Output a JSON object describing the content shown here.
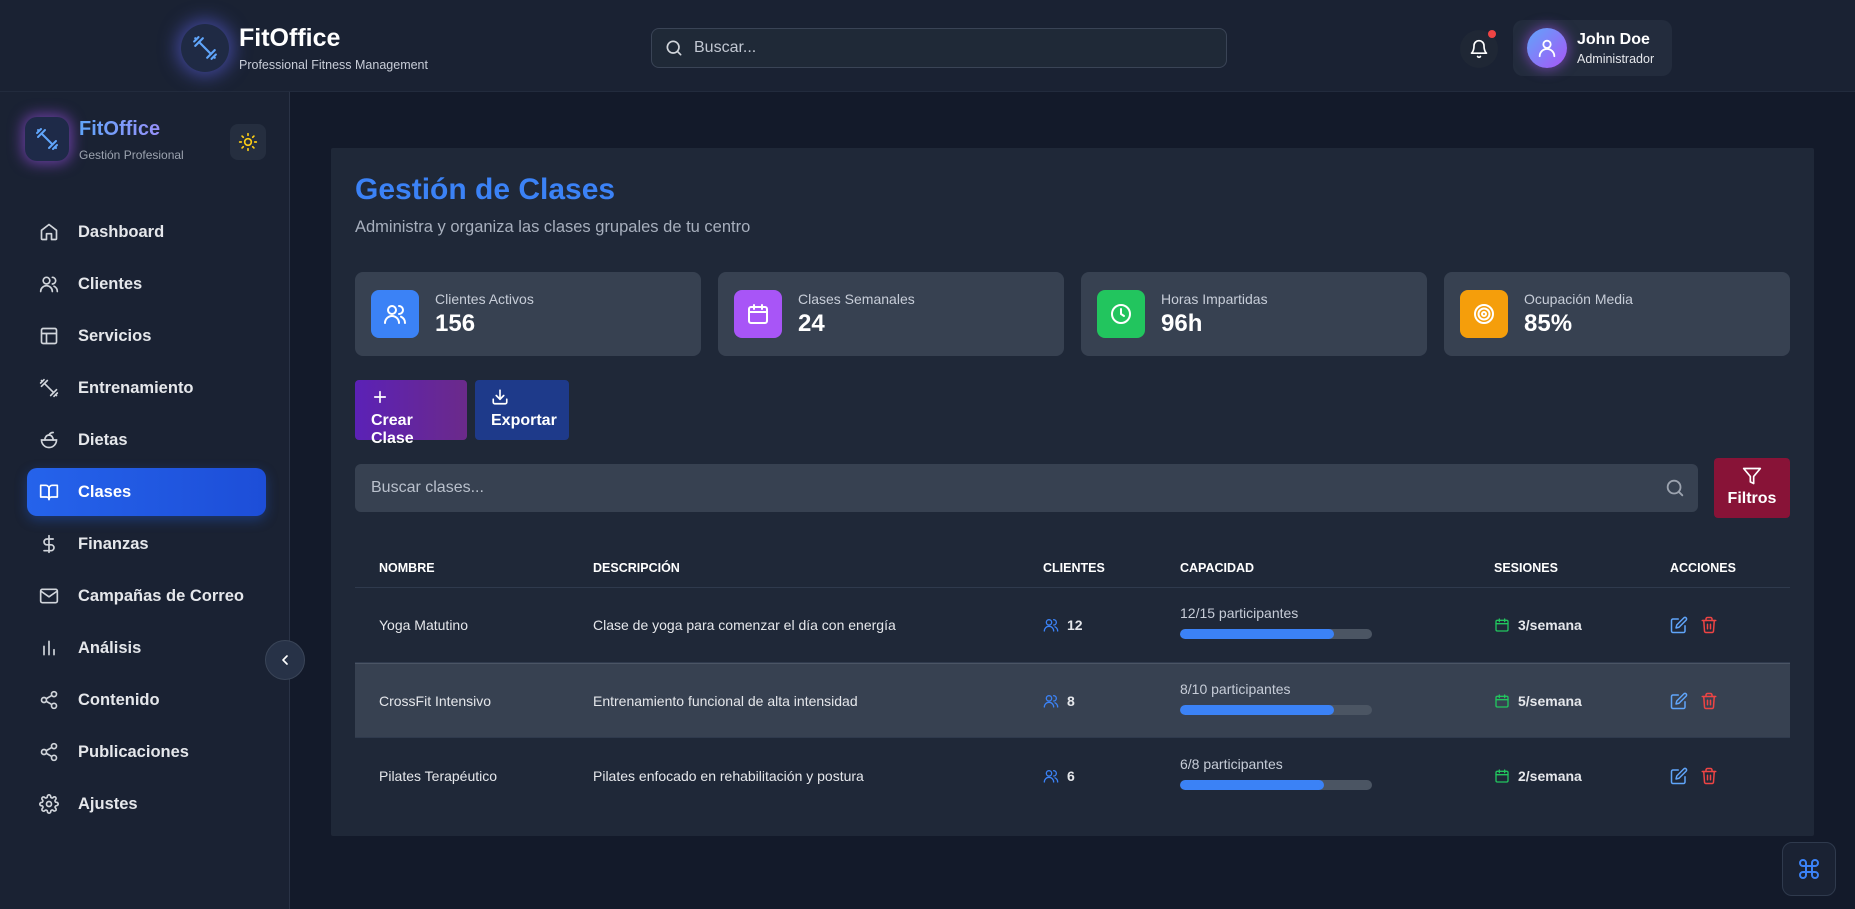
{
  "header": {
    "brand_title": "FitOffice",
    "brand_subtitle": "Professional Fitness Management",
    "search_placeholder": "Buscar...",
    "user_name": "John Doe",
    "user_role": "Administrador"
  },
  "sidebar": {
    "brand_title": "FitOffice",
    "brand_subtitle": "Gestión Profesional",
    "items": [
      {
        "label": "Dashboard",
        "icon": "home-icon"
      },
      {
        "label": "Clientes",
        "icon": "users-icon"
      },
      {
        "label": "Servicios",
        "icon": "layout-icon"
      },
      {
        "label": "Entrenamiento",
        "icon": "dumbbell-icon"
      },
      {
        "label": "Dietas",
        "icon": "salad-icon"
      },
      {
        "label": "Clases",
        "icon": "book-open-icon",
        "active": true
      },
      {
        "label": "Finanzas",
        "icon": "dollar-icon"
      },
      {
        "label": "Campañas de Correo",
        "icon": "mail-icon"
      },
      {
        "label": "Análisis",
        "icon": "bar-chart-icon"
      },
      {
        "label": "Contenido",
        "icon": "share-icon"
      },
      {
        "label": "Publicaciones",
        "icon": "share-icon"
      },
      {
        "label": "Ajustes",
        "icon": "settings-icon"
      }
    ]
  },
  "main": {
    "title": "Gestión de Clases",
    "subtitle": "Administra y organiza las clases grupales de tu centro",
    "stats": [
      {
        "label": "Clientes Activos",
        "value": "156",
        "icon": "users-icon",
        "color": "#3b82f6"
      },
      {
        "label": "Clases Semanales",
        "value": "24",
        "icon": "calendar-icon",
        "color": "#a855f7"
      },
      {
        "label": "Horas Impartidas",
        "value": "96h",
        "icon": "clock-icon",
        "color": "#22c55e"
      },
      {
        "label": "Ocupación Media",
        "value": "85%",
        "icon": "target-icon",
        "color": "#f59e0b"
      }
    ],
    "create_label": "Crear Clase",
    "export_label": "Exportar",
    "search_placeholder": "Buscar clases...",
    "filters_label": "Filtros",
    "table": {
      "headers": [
        "NOMBRE",
        "DESCRIPCIÓN",
        "CLIENTES",
        "CAPACIDAD",
        "SESIONES",
        "ACCIONES"
      ],
      "rows": [
        {
          "name": "Yoga Matutino",
          "description": "Clase de yoga para comenzar el día con energía",
          "clients": "12",
          "capacity": "12/15 participantes",
          "fill": 0.8,
          "sessions": "3/semana"
        },
        {
          "name": "CrossFit Intensivo",
          "description": "Entrenamiento funcional de alta intensidad",
          "clients": "8",
          "capacity": "8/10 participantes",
          "fill": 0.8,
          "sessions": "5/semana"
        },
        {
          "name": "Pilates Terapéutico",
          "description": "Pilates enfocado en rehabilitación y postura",
          "clients": "6",
          "capacity": "6/8 participantes",
          "fill": 0.75,
          "sessions": "2/semana"
        }
      ]
    }
  },
  "colors": {
    "accent": "#3b82f6",
    "sessions_green": "#22c55e",
    "delete_red": "#ef4444"
  }
}
